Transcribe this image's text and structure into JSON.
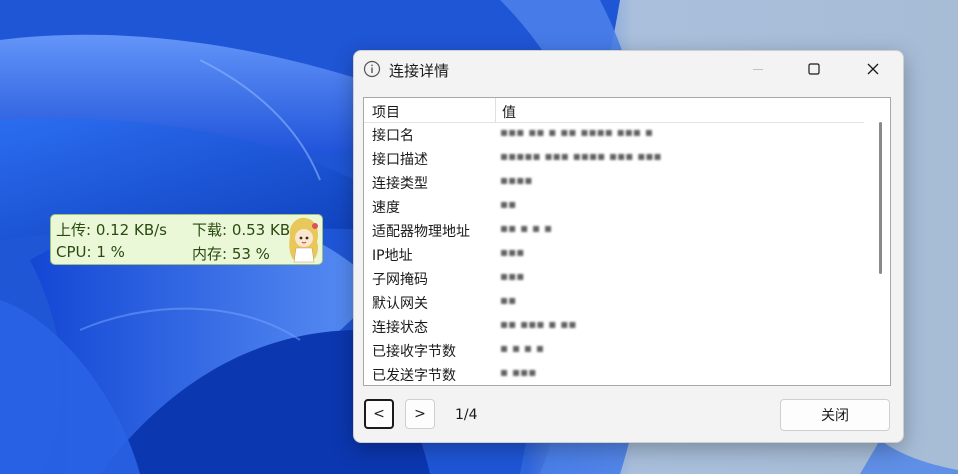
{
  "monitor": {
    "upload": "上传: 0.12 KB/s",
    "download": "下载: 0.53 KB/s",
    "cpu": "CPU: 1 %",
    "memory": "内存: 53 %"
  },
  "dialog": {
    "title": "连接详情",
    "header": {
      "item": "项目",
      "value": "值"
    },
    "rows": [
      {
        "key": "接口名",
        "value": "▪▪▪ ▪▪ ▪ ▪▪ ▪▪▪▪ ▪▪▪ ▪"
      },
      {
        "key": "接口描述",
        "value": "▪▪▪▪▪ ▪▪▪ ▪▪▪▪ ▪▪▪ ▪▪▪"
      },
      {
        "key": "连接类型",
        "value": "▪▪▪▪"
      },
      {
        "key": "速度",
        "value": "▪▪"
      },
      {
        "key": "适配器物理地址",
        "value": "▪▪ ▪ ▪ ▪"
      },
      {
        "key": "IP地址",
        "value": "▪▪▪"
      },
      {
        "key": "子网掩码",
        "value": "▪▪▪"
      },
      {
        "key": "默认网关",
        "value": "▪▪"
      },
      {
        "key": "连接状态",
        "value": "▪▪ ▪▪▪ ▪ ▪▪"
      },
      {
        "key": "已接收字节数",
        "value": "▪ ▪ ▪ ▪"
      },
      {
        "key": "已发送字节数",
        "value": "▪ ▪▪▪"
      }
    ],
    "prev_label": "<",
    "next_label": ">",
    "page": "1/4",
    "close_label": "关闭"
  },
  "colors": {
    "accent": "#0067c0",
    "monitor_bg": "#eaf8d8",
    "dialog_bg": "#f3f3f3"
  },
  "icons": {
    "title": "info-icon",
    "minimize": "minimize-icon",
    "maximize": "maximize-icon",
    "close": "close-icon"
  }
}
